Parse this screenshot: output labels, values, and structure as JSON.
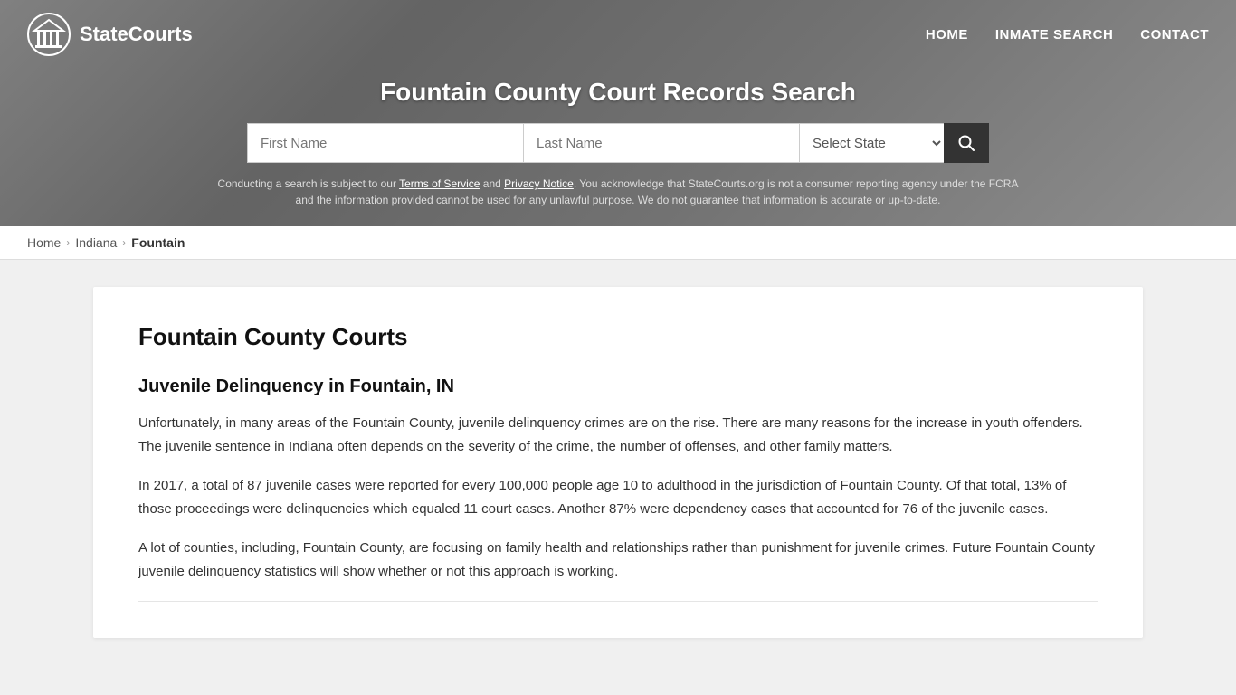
{
  "site": {
    "logo_text": "StateCourts",
    "logo_icon_label": "columns-icon"
  },
  "nav": {
    "home_label": "HOME",
    "inmate_search_label": "INMATE SEARCH",
    "contact_label": "CONTACT"
  },
  "header": {
    "title": "Fountain County Court Records Search",
    "search": {
      "first_name_placeholder": "First Name",
      "last_name_placeholder": "Last Name",
      "state_placeholder": "Select State",
      "search_button_label": "🔍"
    },
    "disclaimer": "Conducting a search is subject to our Terms of Service and Privacy Notice. You acknowledge that StateCourts.org is not a consumer reporting agency under the FCRA and the information provided cannot be used for any unlawful purpose. We do not guarantee that information is accurate or up-to-date.",
    "disclaimer_terms_label": "Terms of Service",
    "disclaimer_privacy_label": "Privacy Notice"
  },
  "breadcrumb": {
    "home_label": "Home",
    "state_label": "Indiana",
    "county_label": "Fountain"
  },
  "content": {
    "page_title": "Fountain County Courts",
    "section1_heading": "Juvenile Delinquency in Fountain, IN",
    "paragraph1": "Unfortunately, in many areas of the Fountain County, juvenile delinquency crimes are on the rise. There are many reasons for the increase in youth offenders. The juvenile sentence in Indiana often depends on the severity of the crime, the number of offenses, and other family matters.",
    "paragraph2": "In 2017, a total of 87 juvenile cases were reported for every 100,000 people age 10 to adulthood in the jurisdiction of Fountain County. Of that total, 13% of those proceedings were delinquencies which equaled 11 court cases. Another 87% were dependency cases that accounted for 76 of the juvenile cases.",
    "paragraph3": "A lot of counties, including, Fountain County, are focusing on family health and relationships rather than punishment for juvenile crimes. Future Fountain County juvenile delinquency statistics will show whether or not this approach is working."
  }
}
